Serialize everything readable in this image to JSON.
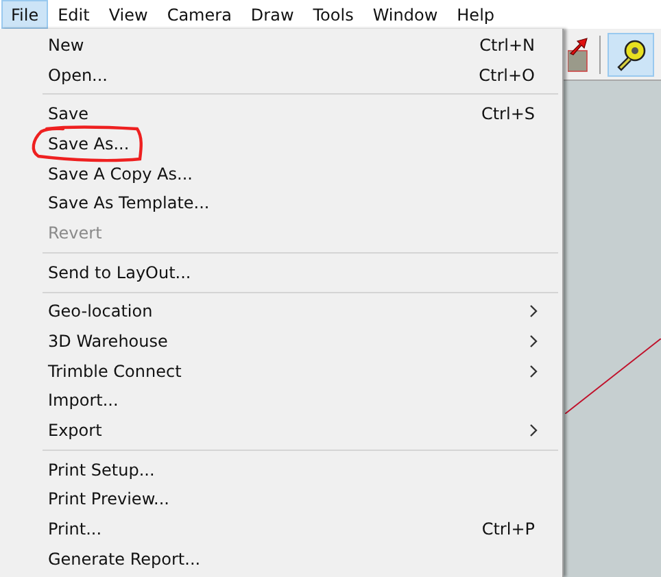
{
  "menubar": [
    {
      "label": "File",
      "selected": true
    },
    {
      "label": "Edit",
      "selected": false
    },
    {
      "label": "View",
      "selected": false
    },
    {
      "label": "Camera",
      "selected": false
    },
    {
      "label": "Draw",
      "selected": false
    },
    {
      "label": "Tools",
      "selected": false
    },
    {
      "label": "Window",
      "selected": false
    },
    {
      "label": "Help",
      "selected": false
    }
  ],
  "toolbar": [
    {
      "kind": "push-pull",
      "selected": false
    },
    {
      "kind": "tape-measure",
      "selected": true
    }
  ],
  "menu": [
    {
      "kind": "item",
      "label": "New",
      "shortcut": "Ctrl+N",
      "submenu": false,
      "disabled": false
    },
    {
      "kind": "item",
      "label": "Open...",
      "shortcut": "Ctrl+O",
      "submenu": false,
      "disabled": false
    },
    {
      "kind": "separator"
    },
    {
      "kind": "item",
      "label": "Save",
      "shortcut": "Ctrl+S",
      "submenu": false,
      "disabled": false
    },
    {
      "kind": "item",
      "label": "Save As...",
      "submenu": false,
      "disabled": false,
      "circled": true
    },
    {
      "kind": "item",
      "label": "Save A Copy As...",
      "submenu": false,
      "disabled": false
    },
    {
      "kind": "item",
      "label": "Save As Template...",
      "submenu": false,
      "disabled": false
    },
    {
      "kind": "item",
      "label": "Revert",
      "submenu": false,
      "disabled": true
    },
    {
      "kind": "separator"
    },
    {
      "kind": "item",
      "label": "Send to LayOut...",
      "submenu": false,
      "disabled": false
    },
    {
      "kind": "separator"
    },
    {
      "kind": "item",
      "label": "Geo-location",
      "submenu": true,
      "disabled": false
    },
    {
      "kind": "item",
      "label": "3D Warehouse",
      "submenu": true,
      "disabled": false
    },
    {
      "kind": "item",
      "label": "Trimble Connect",
      "submenu": true,
      "disabled": false
    },
    {
      "kind": "item",
      "label": "Import...",
      "submenu": false,
      "disabled": false
    },
    {
      "kind": "item",
      "label": "Export",
      "submenu": true,
      "disabled": false
    },
    {
      "kind": "separator"
    },
    {
      "kind": "item",
      "label": "Print Setup...",
      "submenu": false,
      "disabled": false
    },
    {
      "kind": "item",
      "label": "Print Preview...",
      "submenu": false,
      "disabled": false
    },
    {
      "kind": "item",
      "label": "Print...",
      "shortcut": "Ctrl+P",
      "submenu": false,
      "disabled": false
    },
    {
      "kind": "item",
      "label": "Generate Report...",
      "submenu": false,
      "disabled": false
    }
  ]
}
